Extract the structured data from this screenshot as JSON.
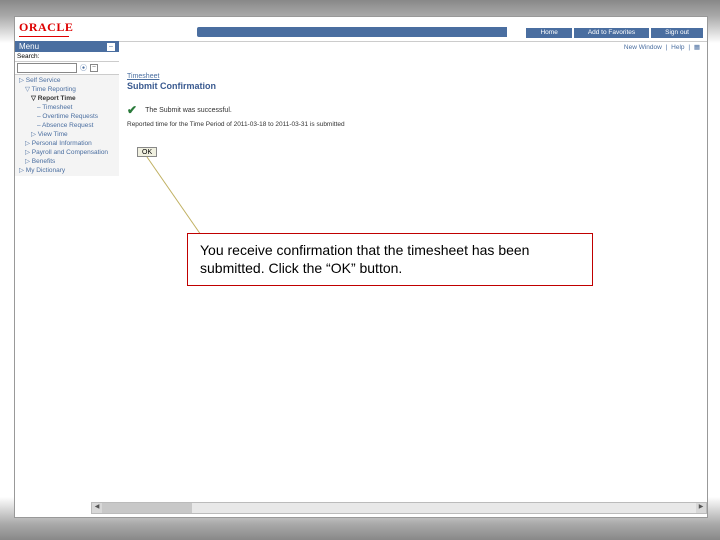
{
  "header": {
    "logo_text": "ORACLE",
    "nav": [
      "Home",
      "Add to Favorites",
      "Sign out"
    ],
    "top_links": [
      "New Window",
      "Help"
    ]
  },
  "menu": {
    "title": "Menu",
    "search_label": "Search:",
    "items_l0": "▷ Self Service",
    "items_l1a": "▽ Time Reporting",
    "items_l2a": "▽ Report Time",
    "items_l3a": "– Timesheet",
    "items_l3b": "– Overtime Requests",
    "items_l3c": "– Absence Request",
    "items_l2b": "▷ View Time",
    "items_l1b": "▷ Personal Information",
    "items_l1c": "▷ Payroll and Compensation",
    "items_l1d": "▷ Benefits",
    "items_l0b": "▷ My Dictionary"
  },
  "main": {
    "breadcrumb": "Timesheet",
    "title": "Submit Confirmation",
    "confirm_text": "The Submit was successful.",
    "sub_text": "Reported time for the Time Period of 2011-03-18 to 2011-03-31 is submitted",
    "ok_label": "OK"
  },
  "callout": {
    "text": "You receive confirmation that the timesheet has been submitted.  Click the “OK” button."
  }
}
